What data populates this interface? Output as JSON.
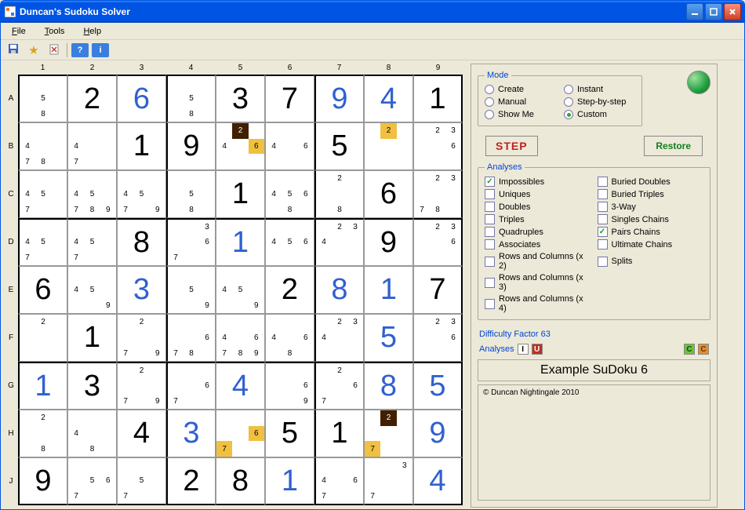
{
  "window": {
    "title": "Duncan's Sudoku Solver"
  },
  "menu": {
    "file": "File",
    "tools": "Tools",
    "help": "Help"
  },
  "toolbar_icons": {
    "save": "save-icon",
    "star": "star-icon",
    "clear": "clear-icon",
    "help": "?",
    "info": "i"
  },
  "board": {
    "cols": [
      "1",
      "2",
      "3",
      "4",
      "5",
      "6",
      "7",
      "8",
      "9"
    ],
    "rows": [
      "A",
      "B",
      "C",
      "D",
      "E",
      "F",
      "G",
      "H",
      "J"
    ],
    "cells": [
      [
        {
          "c": [
            "",
            "",
            "",
            "",
            "5",
            "",
            "",
            "8",
            ""
          ]
        },
        {
          "v": "2",
          "k": "black"
        },
        {
          "v": "6",
          "k": "blue"
        },
        {
          "c": [
            "",
            "",
            "",
            "",
            "5",
            "",
            "",
            "8",
            ""
          ]
        },
        {
          "v": "3",
          "k": "black"
        },
        {
          "v": "7",
          "k": "black"
        },
        {
          "v": "9",
          "k": "blue"
        },
        {
          "v": "4",
          "k": "blue"
        },
        {
          "v": "1",
          "k": "black"
        }
      ],
      [
        {
          "c": [
            "",
            "",
            "",
            "4",
            "",
            "",
            "7",
            "8",
            ""
          ]
        },
        {
          "c": [
            "",
            "",
            "",
            "4",
            "",
            "",
            "7",
            "",
            ""
          ]
        },
        {
          "v": "1",
          "k": "black"
        },
        {
          "v": "9",
          "k": "black"
        },
        {
          "c": [
            "",
            "2",
            "",
            "4",
            "",
            "6",
            "",
            "",
            ""
          ],
          "hl": {
            "1": "dark",
            "5": "yellow"
          }
        },
        {
          "c": [
            "",
            "",
            "",
            "4",
            "",
            "6",
            "",
            "",
            ""
          ]
        },
        {
          "v": "5",
          "k": "black"
        },
        {
          "c": [
            "",
            "2",
            "",
            "",
            "",
            "",
            "",
            "",
            ""
          ],
          "hl": {
            "1": "yellow"
          }
        },
        {
          "c": [
            "",
            "2",
            "3",
            "",
            "",
            "6",
            "",
            "",
            ""
          ]
        }
      ],
      [
        {
          "c": [
            "",
            "",
            "",
            "4",
            "5",
            "",
            "7",
            "",
            ""
          ]
        },
        {
          "c": [
            "",
            "",
            "",
            "4",
            "5",
            "",
            "7",
            "8",
            "9"
          ]
        },
        {
          "c": [
            "",
            "",
            "",
            "4",
            "5",
            "",
            "7",
            "",
            "9"
          ]
        },
        {
          "c": [
            "",
            "",
            "",
            "",
            "5",
            "",
            "",
            "8",
            ""
          ]
        },
        {
          "v": "1",
          "k": "black"
        },
        {
          "c": [
            "",
            "",
            "",
            "4",
            "5",
            "6",
            "",
            "8",
            ""
          ]
        },
        {
          "c": [
            "",
            "2",
            "",
            "",
            "",
            "",
            "",
            "8",
            ""
          ]
        },
        {
          "v": "6",
          "k": "black"
        },
        {
          "c": [
            "",
            "2",
            "3",
            "",
            "",
            "",
            "7",
            "8",
            ""
          ]
        }
      ],
      [
        {
          "c": [
            "",
            "",
            "",
            "4",
            "5",
            "",
            "7",
            "",
            ""
          ]
        },
        {
          "c": [
            "",
            "",
            "",
            "4",
            "5",
            "",
            "7",
            "",
            ""
          ]
        },
        {
          "v": "8",
          "k": "black"
        },
        {
          "c": [
            "",
            "",
            "3",
            "",
            "",
            "6",
            "7",
            "",
            ""
          ]
        },
        {
          "v": "1",
          "k": "blue"
        },
        {
          "c": [
            "",
            "",
            "",
            "4",
            "5",
            "6",
            "",
            "",
            ""
          ]
        },
        {
          "c": [
            "",
            "2",
            "3",
            "4",
            "",
            "",
            "",
            "",
            ""
          ]
        },
        {
          "v": "9",
          "k": "black"
        },
        {
          "c": [
            "",
            "2",
            "3",
            "",
            "",
            "6",
            "",
            "",
            ""
          ]
        }
      ],
      [
        {
          "v": "6",
          "k": "black"
        },
        {
          "c": [
            "",
            "",
            "",
            "4",
            "5",
            "",
            "",
            "",
            "9"
          ]
        },
        {
          "v": "3",
          "k": "blue"
        },
        {
          "c": [
            "",
            "",
            "",
            "",
            "5",
            "",
            "",
            "",
            "9"
          ]
        },
        {
          "c": [
            "",
            "",
            "",
            "4",
            "5",
            "",
            "",
            "",
            "9"
          ]
        },
        {
          "v": "2",
          "k": "black"
        },
        {
          "v": "8",
          "k": "blue"
        },
        {
          "v": "1",
          "k": "blue"
        },
        {
          "v": "7",
          "k": "black"
        }
      ],
      [
        {
          "c": [
            "",
            "2",
            "",
            "",
            "",
            "",
            "",
            "",
            ""
          ]
        },
        {
          "v": "1",
          "k": "black"
        },
        {
          "c": [
            "",
            "2",
            "",
            "",
            "",
            "",
            "7",
            "",
            "9"
          ]
        },
        {
          "c": [
            "",
            "",
            "",
            "",
            "",
            "6",
            "7",
            "8",
            ""
          ]
        },
        {
          "c": [
            "",
            "",
            "",
            "4",
            "",
            "6",
            "7",
            "8",
            "9"
          ]
        },
        {
          "c": [
            "",
            "",
            "",
            "4",
            "",
            "6",
            "",
            "8",
            ""
          ]
        },
        {
          "c": [
            "",
            "2",
            "3",
            "4",
            "",
            "",
            "",
            "",
            ""
          ]
        },
        {
          "v": "5",
          "k": "blue"
        },
        {
          "c": [
            "",
            "2",
            "3",
            "",
            "",
            "6",
            "",
            "",
            ""
          ]
        }
      ],
      [
        {
          "v": "1",
          "k": "blue"
        },
        {
          "v": "3",
          "k": "black"
        },
        {
          "c": [
            "",
            "2",
            "",
            "",
            "",
            "",
            "7",
            "",
            "9"
          ]
        },
        {
          "c": [
            "",
            "",
            "",
            "",
            "",
            "6",
            "7",
            "",
            ""
          ]
        },
        {
          "v": "4",
          "k": "blue"
        },
        {
          "c": [
            "",
            "",
            "",
            "",
            "",
            "6",
            "",
            "",
            "9"
          ]
        },
        {
          "c": [
            "",
            "2",
            "",
            "",
            "",
            "6",
            "7",
            "",
            ""
          ]
        },
        {
          "v": "8",
          "k": "blue"
        },
        {
          "v": "5",
          "k": "blue"
        }
      ],
      [
        {
          "c": [
            "",
            "2",
            "",
            "",
            "",
            "",
            "",
            "8",
            ""
          ]
        },
        {
          "c": [
            "",
            "",
            "",
            "4",
            "",
            "",
            "",
            "8",
            ""
          ]
        },
        {
          "v": "4",
          "k": "black"
        },
        {
          "v": "3",
          "k": "blue"
        },
        {
          "c": [
            "",
            "",
            "",
            "",
            "",
            "6",
            "7",
            "",
            ""
          ],
          "hl": {
            "5": "yellow",
            "6": "yellow"
          }
        },
        {
          "v": "5",
          "k": "black"
        },
        {
          "v": "1",
          "k": "black"
        },
        {
          "c": [
            "",
            "2",
            "",
            "",
            "",
            "",
            "7",
            "",
            ""
          ],
          "hl": {
            "1": "dark",
            "6": "yellow"
          }
        },
        {
          "v": "9",
          "k": "blue"
        }
      ],
      [
        {
          "v": "9",
          "k": "black"
        },
        {
          "c": [
            "",
            "",
            "",
            "",
            "5",
            "6",
            "7",
            "",
            ""
          ]
        },
        {
          "c": [
            "",
            "",
            "",
            "",
            "5",
            "",
            "7",
            "",
            ""
          ]
        },
        {
          "v": "2",
          "k": "black"
        },
        {
          "v": "8",
          "k": "black"
        },
        {
          "v": "1",
          "k": "blue"
        },
        {
          "c": [
            "",
            "",
            "",
            "4",
            "",
            "6",
            "7",
            "",
            ""
          ]
        },
        {
          "c": [
            "",
            "",
            "3",
            "",
            "",
            "",
            "7",
            "",
            ""
          ]
        },
        {
          "v": "4",
          "k": "blue"
        }
      ]
    ]
  },
  "panel": {
    "mode_legend": "Mode",
    "modes": [
      {
        "label": "Create",
        "checked": false
      },
      {
        "label": "Instant",
        "checked": false
      },
      {
        "label": "Manual",
        "checked": false
      },
      {
        "label": "Step-by-step",
        "checked": false
      },
      {
        "label": "Show Me",
        "checked": false
      },
      {
        "label": "Custom",
        "checked": true
      }
    ],
    "step": "STEP",
    "restore": "Restore",
    "analyses_legend": "Analyses",
    "analyses": [
      {
        "label": "Impossibles",
        "checked": true
      },
      {
        "label": "Buried Doubles",
        "checked": false
      },
      {
        "label": "Uniques",
        "checked": false
      },
      {
        "label": "Buried Triples",
        "checked": false
      },
      {
        "label": "Doubles",
        "checked": false
      },
      {
        "label": "3-Way",
        "checked": false
      },
      {
        "label": "Triples",
        "checked": false
      },
      {
        "label": "Singles Chains",
        "checked": false
      },
      {
        "label": "Quadruples",
        "checked": false
      },
      {
        "label": "Pairs Chains",
        "checked": true
      },
      {
        "label": "Associates",
        "checked": false
      },
      {
        "label": "Ultimate Chains",
        "checked": false
      },
      {
        "label": "Rows and Columns (x 2)",
        "checked": false
      },
      {
        "label": "Splits",
        "checked": false
      },
      {
        "label": "Rows and Columns (x 3)",
        "checked": false,
        "span": true
      },
      {
        "label": "Rows and Columns (x 4)",
        "checked": false,
        "span": true
      }
    ],
    "difficulty": "Difficulty Factor 63",
    "analyses_label": "Analyses",
    "status": "Example SuDoku 6",
    "copyright": "© Duncan Nightingale 2010"
  }
}
